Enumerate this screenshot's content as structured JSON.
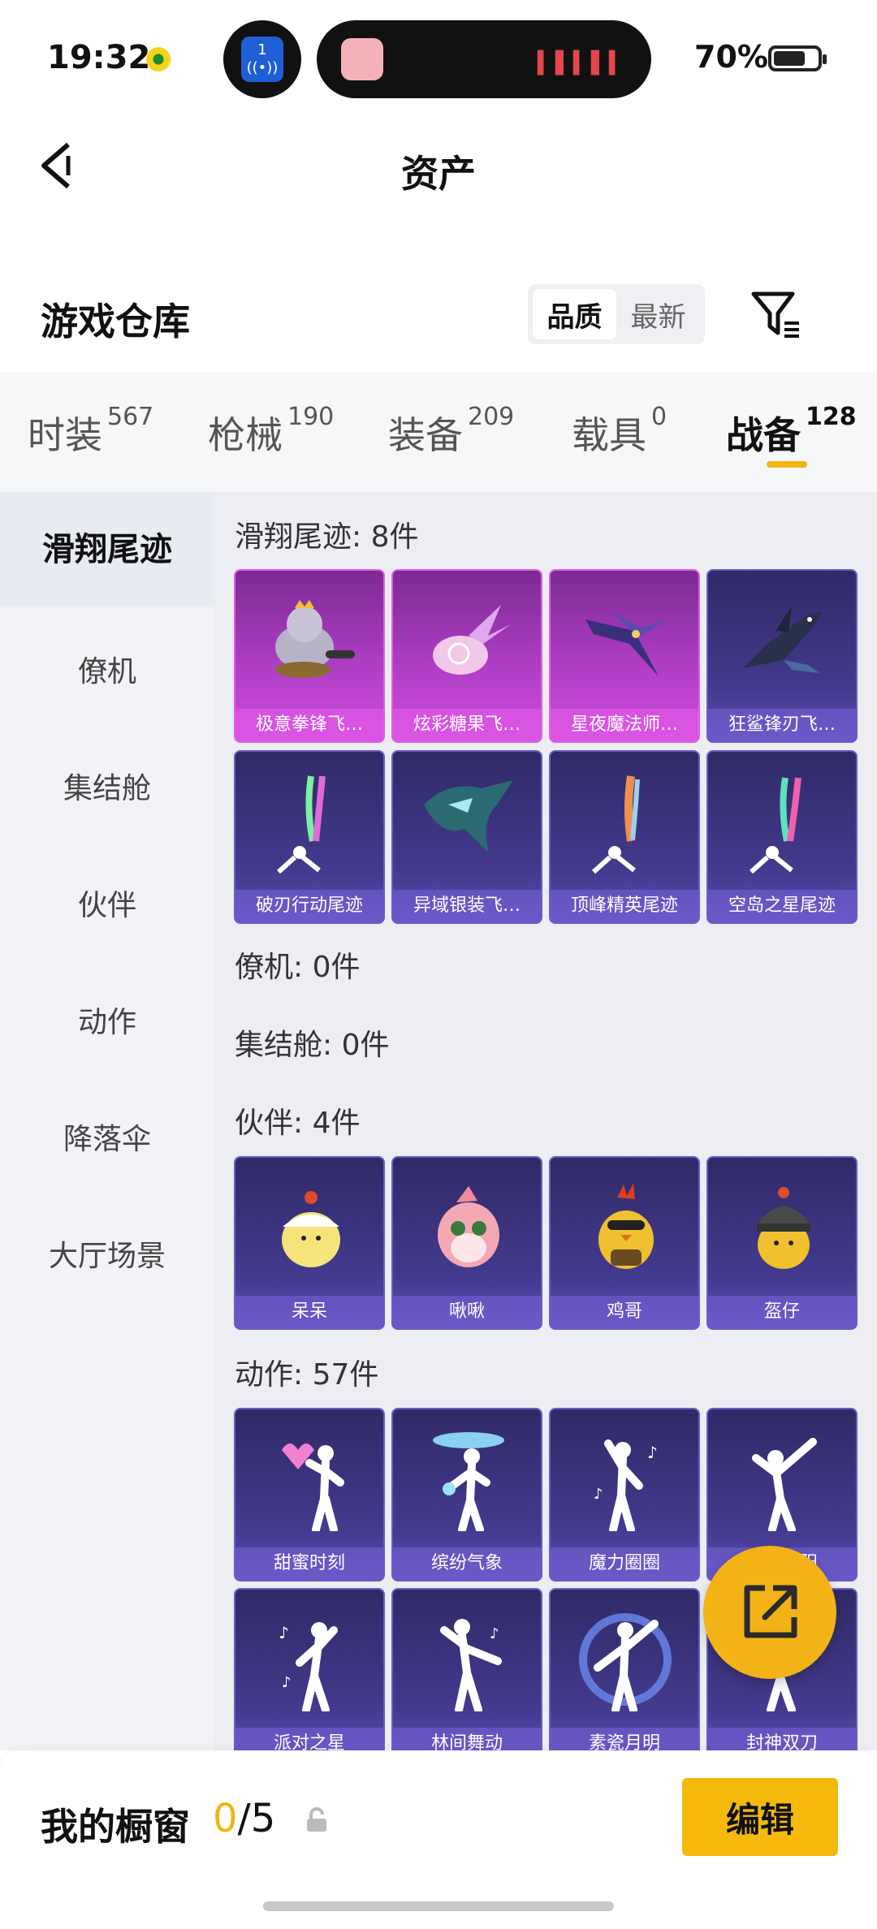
{
  "status_bar": {
    "time": "19:32",
    "battery": "70%",
    "battery_level": 0.7,
    "pill_badge": "1"
  },
  "header": {
    "title": "资产"
  },
  "warehouse": {
    "title": "游戏仓库",
    "sort_options": [
      "品质",
      "最新"
    ],
    "sort_active": "品质"
  },
  "tabs": [
    {
      "label": "时装",
      "count": "567"
    },
    {
      "label": "枪械",
      "count": "190"
    },
    {
      "label": "装备",
      "count": "209"
    },
    {
      "label": "载具",
      "count": "0"
    },
    {
      "label": "战备",
      "count": "128",
      "active": true
    }
  ],
  "side_nav": [
    "滑翔尾迹",
    "僚机",
    "集结舱",
    "伙伴",
    "动作",
    "降落伞",
    "大厅场景"
  ],
  "sections": {
    "glide": {
      "title": "滑翔尾迹: 8件",
      "items": [
        "极意拳锋飞…",
        "炫彩糖果飞…",
        "星夜魔法师…",
        "狂鲨锋刃飞…",
        "破刃行动尾迹",
        "异域银装飞…",
        "顶峰精英尾迹",
        "空岛之星尾迹"
      ]
    },
    "wingman": {
      "title": "僚机: 0件"
    },
    "pod": {
      "title": "集结舱: 0件"
    },
    "partner": {
      "title": "伙伴: 4件",
      "items": [
        "呆呆",
        "啾啾",
        "鸡哥",
        "盔仔"
      ]
    },
    "emote": {
      "title": "动作: 57件",
      "items": [
        "甜蜜时刻",
        "缤纷气象",
        "魔力圈圈",
        "冷面骄阳",
        "派对之星",
        "林间舞动",
        "素瓷月明",
        "封神双刀"
      ]
    }
  },
  "bottom_bar": {
    "label": "我的橱窗",
    "current": "0",
    "total": "/5",
    "edit_label": "编辑"
  },
  "colors": {
    "accent": "#f3b316",
    "card_blue": "#443a8f",
    "card_purple": "#b33fc8"
  }
}
